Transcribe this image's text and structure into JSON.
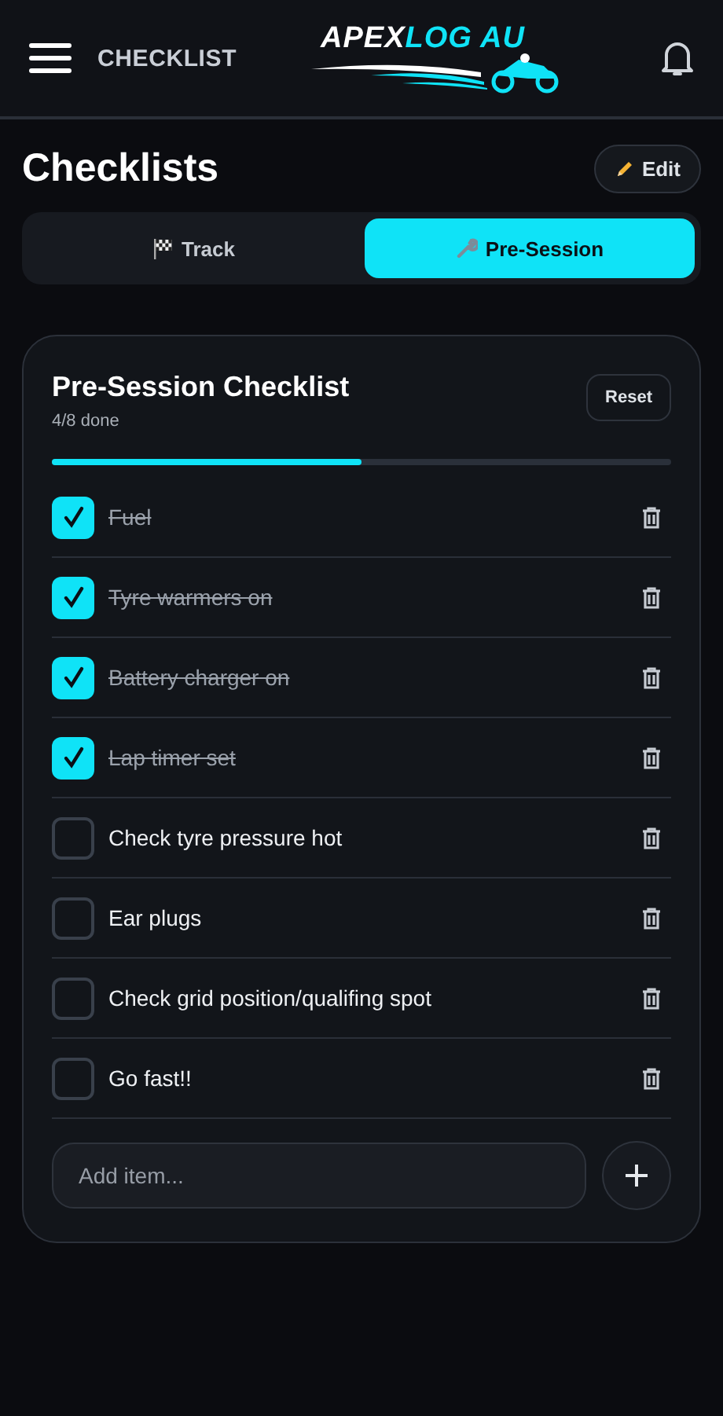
{
  "header": {
    "title": "CHECKLIST",
    "logo": {
      "first": "APEX",
      "second": "LOG AU"
    }
  },
  "page": {
    "title": "Checklists",
    "edit_button": "Edit"
  },
  "tabs": [
    {
      "label": "Track",
      "selected": false
    },
    {
      "label": "Pre-Session",
      "selected": true
    }
  ],
  "checklist": {
    "title": "Pre-Session Checklist",
    "progress_text": "4/8 done",
    "level": 0.5,
    "reset_button": "Reset",
    "items": [
      {
        "label": "Fuel",
        "checked": true
      },
      {
        "label": "Tyre warmers on",
        "checked": true
      },
      {
        "label": "Battery charger on",
        "checked": true
      },
      {
        "label": "Lap timer set",
        "checked": true
      },
      {
        "label": "Check tyre pressure hot",
        "checked": false
      },
      {
        "label": "Ear plugs",
        "checked": false
      },
      {
        "label": "Check grid position/qualifing spot",
        "checked": false
      },
      {
        "label": "Go fast!!",
        "checked": false
      }
    ],
    "add_field": {
      "placeholder": "Add item..."
    }
  }
}
